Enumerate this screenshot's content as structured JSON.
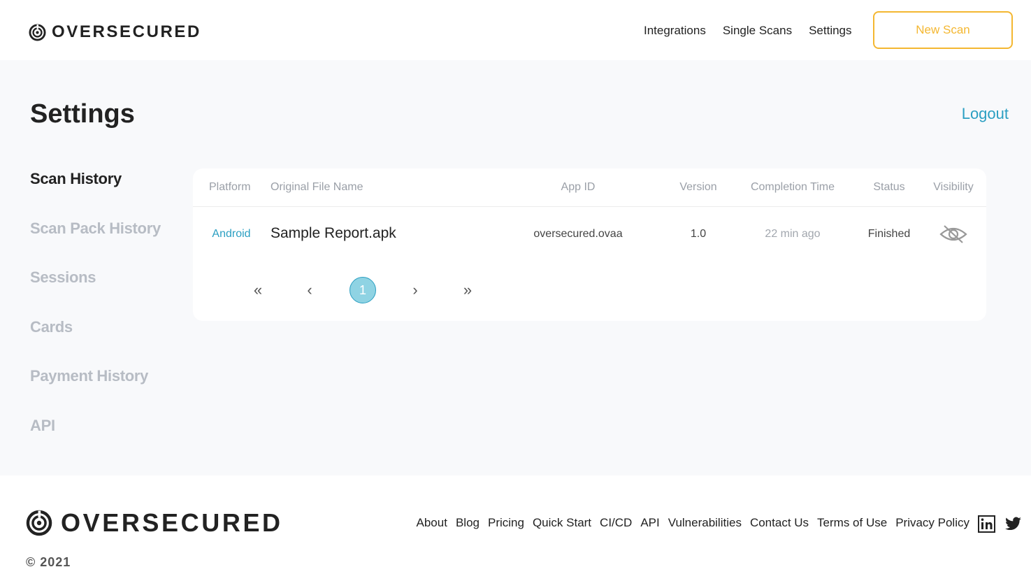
{
  "brand": {
    "name": "OVERSECURED"
  },
  "nav": {
    "items": [
      "Integrations",
      "Single Scans",
      "Settings"
    ],
    "new_scan": "New Scan"
  },
  "page": {
    "title": "Settings",
    "logout": "Logout"
  },
  "sidebar": {
    "items": [
      "Scan History",
      "Scan Pack History",
      "Sessions",
      "Cards",
      "Payment History",
      "API"
    ],
    "active": "Scan History"
  },
  "table": {
    "columns": [
      "Platform",
      "Original File Name",
      "App ID",
      "Version",
      "Completion Time",
      "Status",
      "Visibility"
    ],
    "rows": [
      {
        "platform": "Android",
        "file_name": "Sample Report.apk",
        "app_id": "oversecured.ovaa",
        "version": "1.0",
        "completion_time": "22 min ago",
        "status": "Finished",
        "visibility_icon": "eye-hidden-icon"
      }
    ]
  },
  "pagination": {
    "first": "«",
    "prev": "‹",
    "current": "1",
    "next": "›",
    "last": "»"
  },
  "footer": {
    "brand": "OVERSECURED",
    "copyright": "© 2021",
    "links": [
      "About",
      "Blog",
      "Pricing",
      "Quick Start",
      "CI/CD",
      "API",
      "Vulnerabilities",
      "Contact Us",
      "Terms of Use",
      "Privacy Policy"
    ],
    "social": [
      "linkedin-icon",
      "twitter-icon"
    ]
  },
  "colors": {
    "accent": "#2b9fc2",
    "warning": "#f4b731",
    "page_bg": "#f8f9fb",
    "pager_active": "#8fd3e3"
  }
}
